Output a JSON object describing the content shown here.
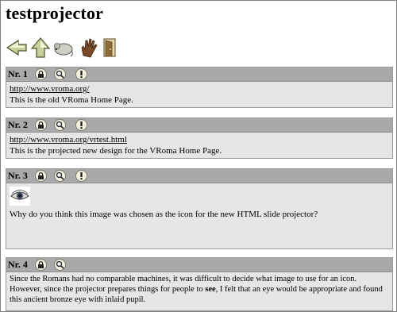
{
  "page": {
    "title": "testprojector"
  },
  "toolbar": {
    "icons": [
      "back-arrow-icon",
      "up-arrow-icon",
      "mouse-icon",
      "hand-icon",
      "door-icon"
    ]
  },
  "slides": [
    {
      "number": "Nr. 1",
      "link": "http://www.vroma.org/",
      "text": "This is the old VRoma Home Page."
    },
    {
      "number": "Nr. 2",
      "link": "http://www.vroma.org/vrtest.html",
      "text": "This is the projected new design for the VRoma Home Page."
    },
    {
      "number": "Nr. 3",
      "text": "Why do you think this image was chosen as the icon for the new HTML slide projector?"
    },
    {
      "number": "Nr. 4",
      "text_before": "Since the Romans had no comparable machines, it was difficult to decide what image to use for an icon. However, since the projector prepares things for people to ",
      "text_bold": "see",
      "text_after": ", I felt that an eye would be appropriate and found this ancient bronze eye with inlaid pupil."
    }
  ]
}
